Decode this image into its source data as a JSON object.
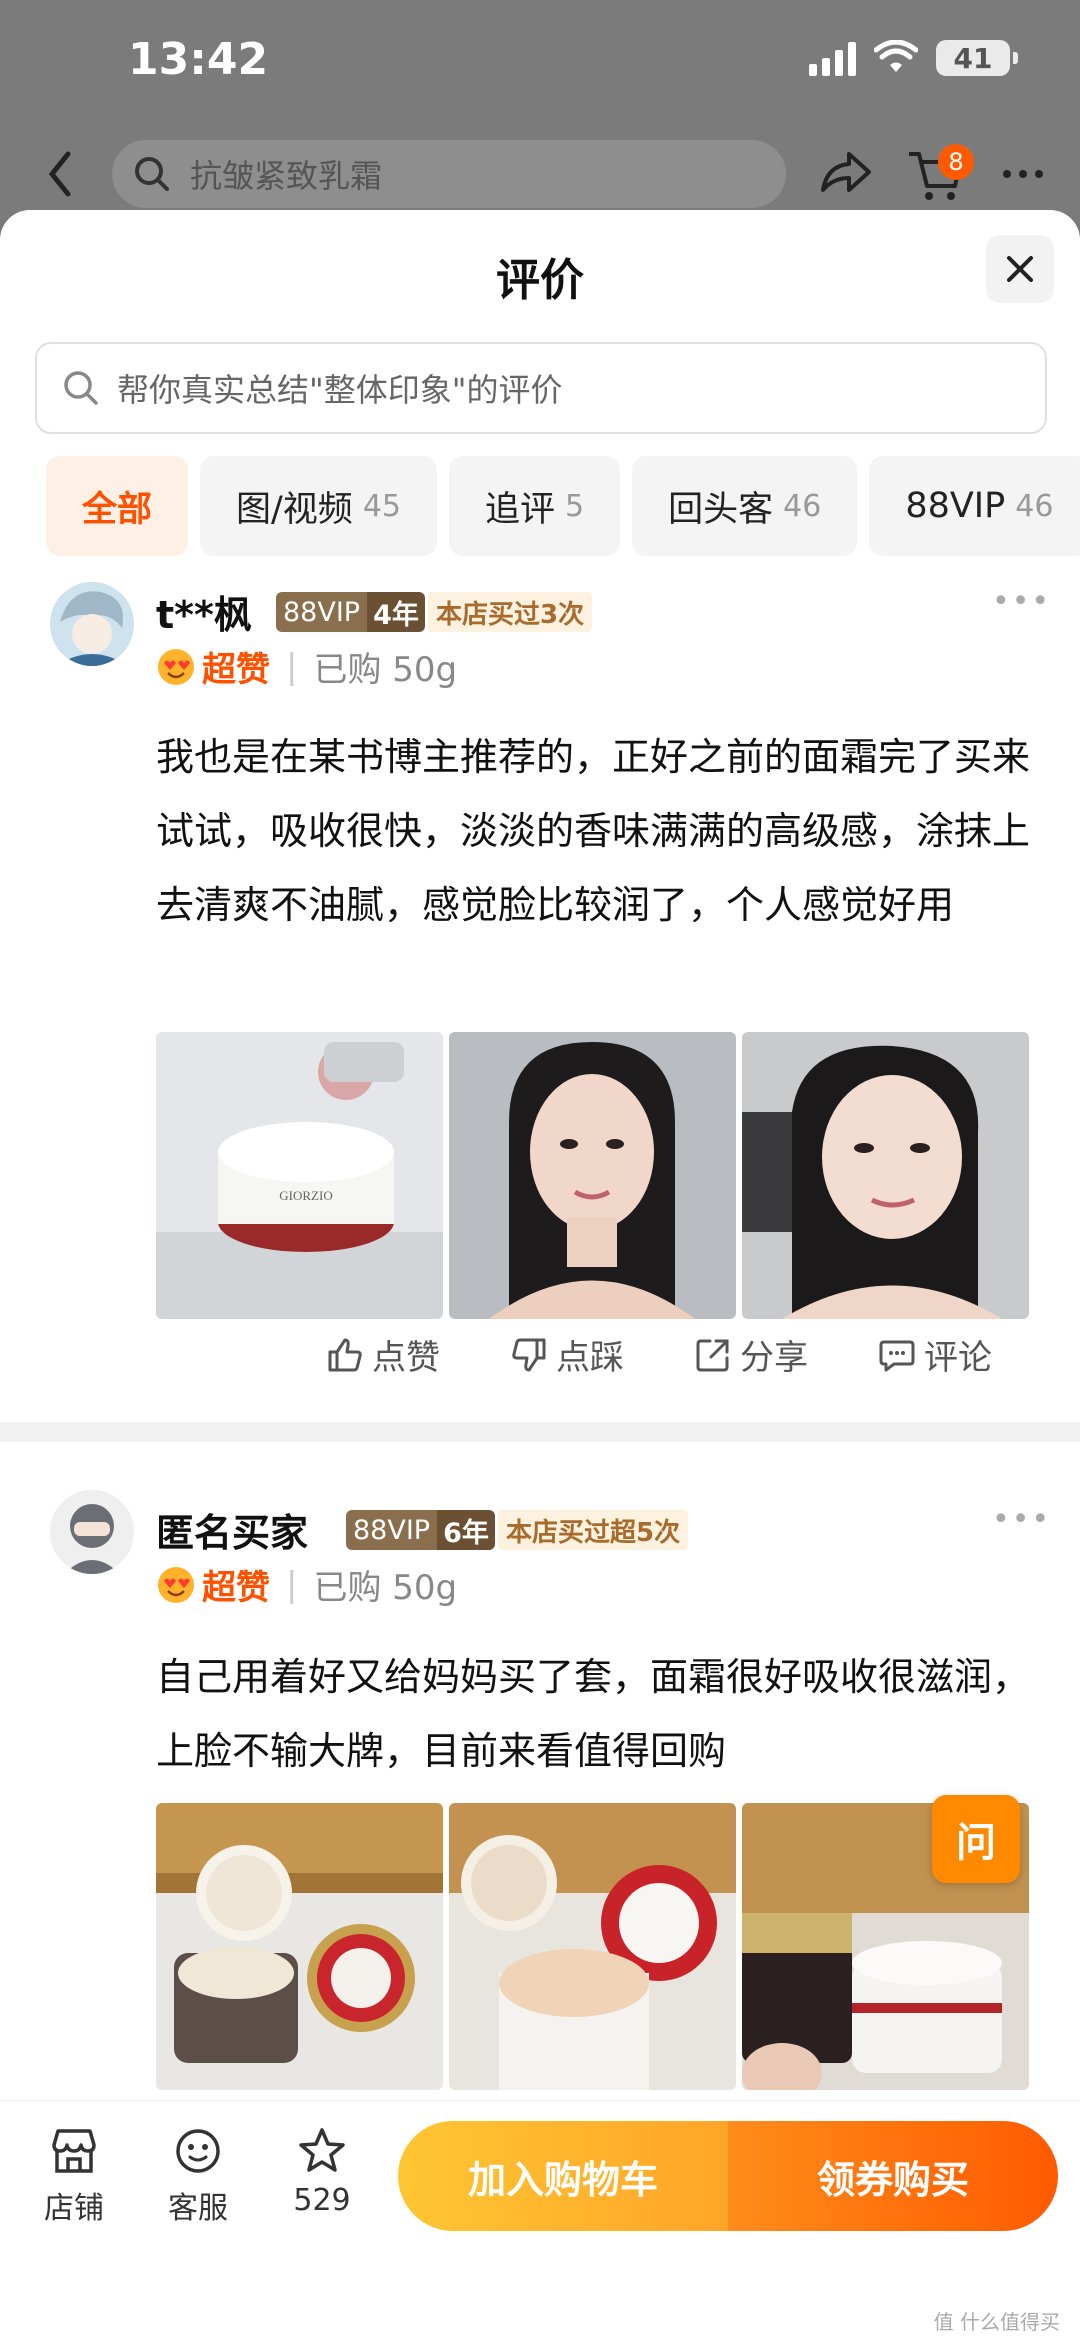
{
  "status": {
    "time": "13:42",
    "battery": "41"
  },
  "nav": {
    "search_placeholder": "抗皱紧致乳霜",
    "cart_count": "8"
  },
  "sheet": {
    "title": "评价",
    "search_placeholder": "帮你真实总结\"整体印象\"的评价"
  },
  "filters": [
    {
      "label": "全部",
      "count": ""
    },
    {
      "label": "图/视频",
      "count": "45"
    },
    {
      "label": "追评",
      "count": "5"
    },
    {
      "label": "回头客",
      "count": "46"
    },
    {
      "label": "88VIP",
      "count": "46"
    }
  ],
  "reviews": [
    {
      "user": "t**枫",
      "vip_label": "88VIP",
      "vip_years": "4年",
      "shop_tag": "本店买过3次",
      "rating": "超赞",
      "bought": "已购 50g",
      "text": "我也是在某书博主推荐的，正好之前的面霜完了买来试试，吸收很快，淡淡的香味满满的高级感，涂抹上去清爽不油腻，感觉脸比较润了，个人感觉好用",
      "photo_brand": "GIORZIO",
      "actions": [
        "点赞",
        "点踩",
        "分享",
        "评论"
      ]
    },
    {
      "user": "匿名买家",
      "vip_label": "88VIP",
      "vip_years": "6年",
      "shop_tag": "本店买过超5次",
      "rating": "超赞",
      "bought": "已购 50g",
      "text": "自己用着好又给妈妈买了套，面霜很好吸收很滋润，上脸不输大牌，目前来看值得回购"
    }
  ],
  "ask_label": "问",
  "bottom": {
    "shop_label": "店铺",
    "service_label": "客服",
    "fav_count": "529",
    "add_cart_label": "加入购物车",
    "buy_label": "领券购买"
  },
  "watermark": "值 什么值得买",
  "colors": {
    "accent": "#ff5000",
    "cart_btn": "#ffb52e",
    "buy_btn": "#ff6a0a",
    "vip": "#8a6f4e"
  }
}
